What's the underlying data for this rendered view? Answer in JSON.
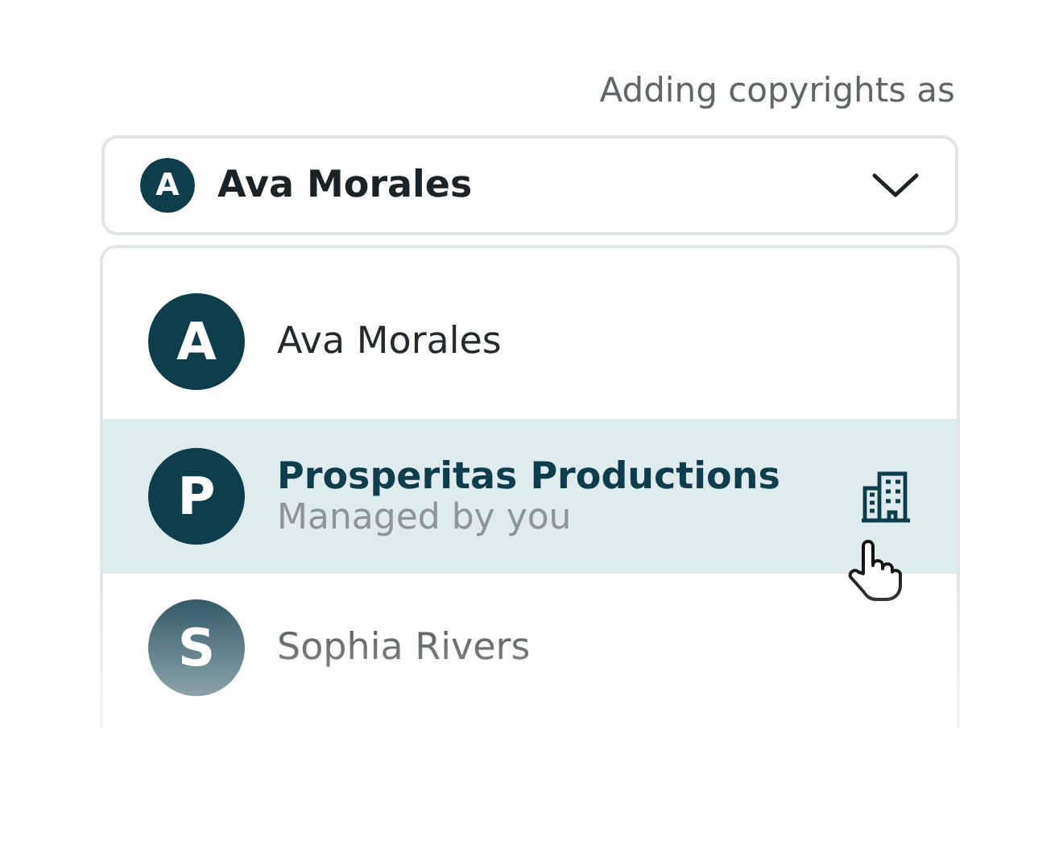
{
  "label": "Adding copyrights as",
  "select": {
    "initial": "A",
    "value": "Ava Morales"
  },
  "options": [
    {
      "kind": "person",
      "initial": "A",
      "name": "Ava Morales",
      "selected": false
    },
    {
      "kind": "organization",
      "initial": "P",
      "name": "Prosperitas Productions",
      "subtitle": "Managed by you",
      "selected": true
    },
    {
      "kind": "person",
      "initial": "S",
      "name": "Sophia Rivers",
      "selected": false
    }
  ]
}
